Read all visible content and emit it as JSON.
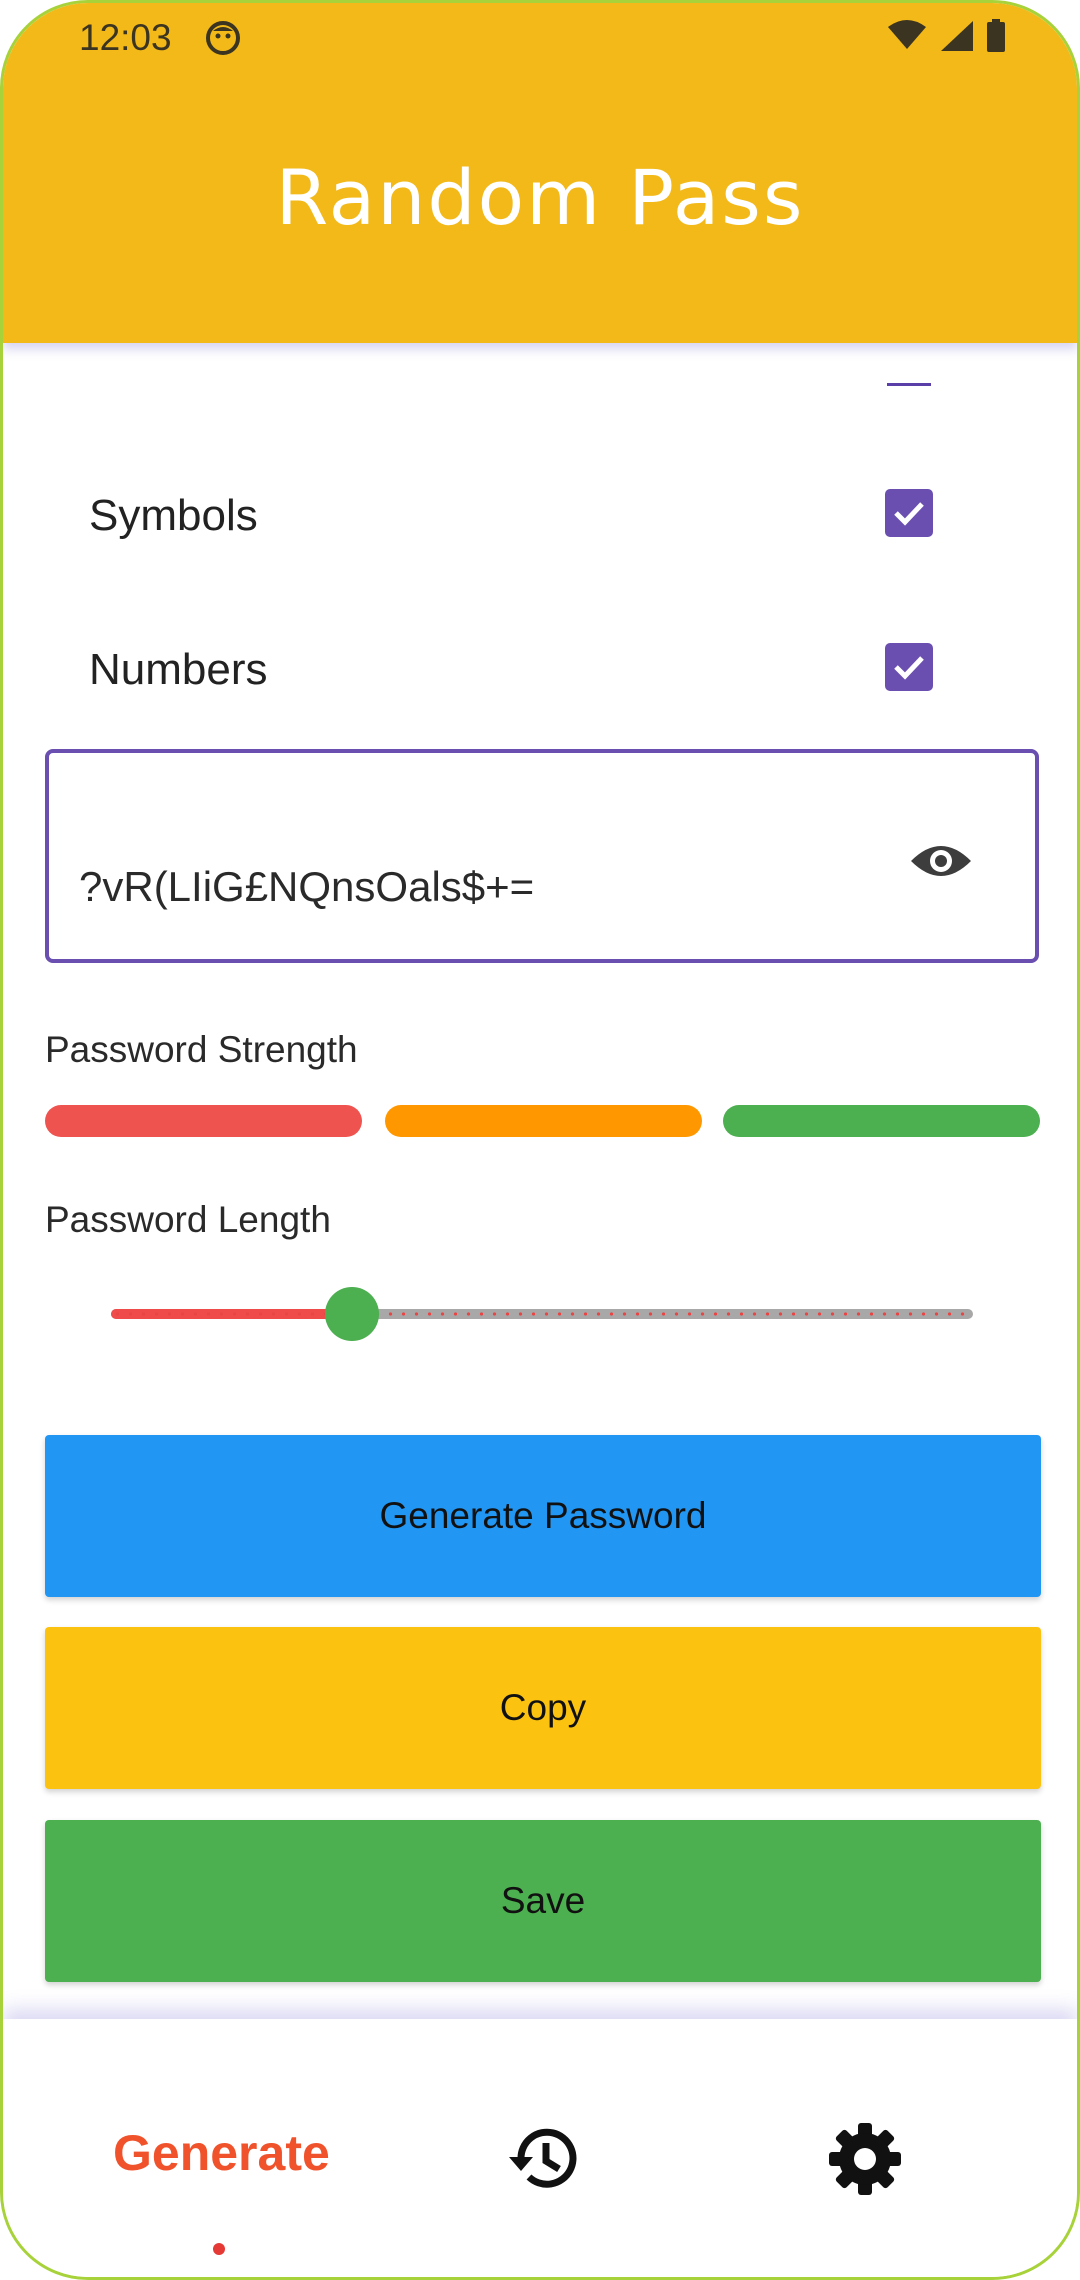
{
  "status_bar": {
    "time": "12:03"
  },
  "app_bar": {
    "title": "Random Pass"
  },
  "options": [
    {
      "label": "Symbols",
      "checked": true
    },
    {
      "label": "Numbers",
      "checked": true
    }
  ],
  "password_field": {
    "value": "?vR(LIiG£NQnsOals$+="
  },
  "strength": {
    "label": "Password Strength",
    "colors": [
      "#ef5350",
      "#ff9800",
      "#4caf50"
    ]
  },
  "length": {
    "label": "Password Length",
    "slider_fraction": 0.28
  },
  "buttons": {
    "generate": "Generate Password",
    "copy": "Copy",
    "save": "Save"
  },
  "bottom_nav": {
    "generate_label": "Generate",
    "icons": [
      "history-icon",
      "settings-icon"
    ]
  },
  "colors": {
    "app_bar": "#f2b919",
    "accent": "#6a4fb0",
    "generate_button": "#2196f3",
    "copy_button": "#fbc20f",
    "save_button": "#4caf50",
    "active_nav": "#f0532c"
  }
}
